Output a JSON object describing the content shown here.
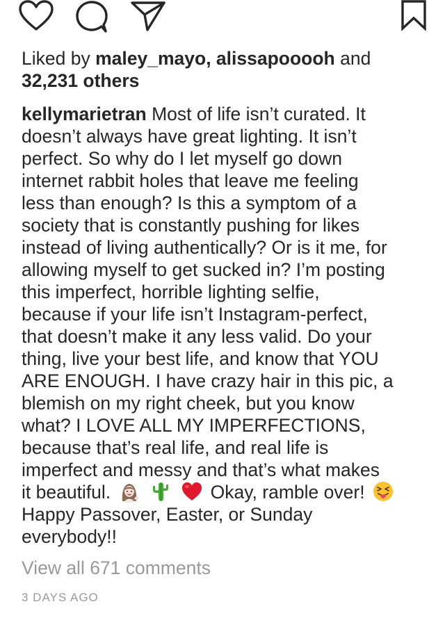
{
  "actions": {
    "like_icon": "heart-icon",
    "comment_icon": "comment-bubble-icon",
    "share_icon": "paper-plane-icon",
    "save_icon": "bookmark-icon"
  },
  "likes": {
    "prefix": "Liked by ",
    "user1": "maley_mayo",
    "separator": ", ",
    "user2": "alissapooooh",
    "and": " and",
    "others": "32,231 others"
  },
  "caption": {
    "author": "kellymarietran",
    "lines": [
      " Most of life isn’t curated. It",
      "doesn’t always have great lighting. It isn’t",
      "perfect. So why do I let myself go down",
      "internet rabbit holes that leave me feeling",
      "less than enough? Is this a symptom of a",
      "society that is constantly pushing for likes",
      "instead of living authentically? Or is it me, for",
      "allowing myself to get sucked in? I’m posting",
      "this imperfect, horrible lighting selfie,",
      "because if your life isn’t Instagram-perfect,",
      "that doesn’t make it any less valid. Do your",
      "thing, live your best life, and know that YOU",
      "ARE ENOUGH. I have crazy hair in this pic, a",
      "blemish on my right cheek, but you know",
      "what? I LOVE ALL MY IMPERFECTIONS,",
      "because that’s real life, and real life is",
      "imperfect and messy and that’s what makes"
    ],
    "line18_text1": "it beautiful.",
    "line18_text2": "Okay, ramble over!",
    "line19": "Happy Passover, Easter, or Sunday",
    "line20": "everybody!!",
    "emojis": [
      "woman-tipping-hand-emoji",
      "cactus-emoji",
      "red-heart-emoji",
      "tongue-out-emoji"
    ]
  },
  "view_comments": "View all 671 comments",
  "timestamp": "3 DAYS AGO",
  "colors": {
    "text": "#262626",
    "muted": "#999999",
    "background": "#ffffff"
  }
}
